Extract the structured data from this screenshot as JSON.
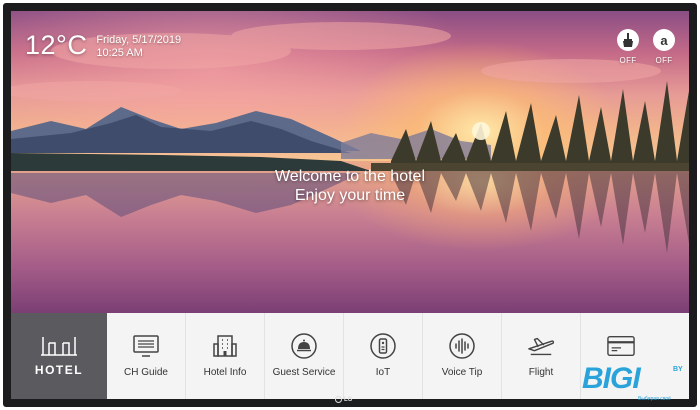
{
  "weather": {
    "temperature": "12°C",
    "date": "Friday, 5/17/2019",
    "time": "10:25 AM"
  },
  "toggles": [
    {
      "icon": "brush-icon",
      "state": "OFF"
    },
    {
      "icon": "do-not-disturb-icon",
      "glyph": "a",
      "state": "OFF"
    }
  ],
  "welcome": {
    "line1": "Welcome to the hotel",
    "line2": "Enjoy your time"
  },
  "menu": {
    "brand_label": "HOTEL",
    "items": [
      {
        "label": "CH Guide",
        "icon": "tv-guide-icon"
      },
      {
        "label": "Hotel Info",
        "icon": "building-icon"
      },
      {
        "label": "Guest Service",
        "icon": "bell-icon"
      },
      {
        "label": "IoT",
        "icon": "iot-remote-icon"
      },
      {
        "label": "Voice Tip",
        "icon": "voice-icon"
      },
      {
        "label": "Flight",
        "icon": "airplane-icon"
      },
      {
        "label": "",
        "icon": "card-icon"
      }
    ]
  },
  "tv_brand": "LG",
  "watermark": {
    "text": "BIGI",
    "suffix": "BY",
    "tagline": "Выбирая своё"
  },
  "colors": {
    "menu_brand_bg": "#5b5b5f",
    "menu_bg": "#f4f4f4",
    "watermark_blue": "#2aa3db"
  }
}
